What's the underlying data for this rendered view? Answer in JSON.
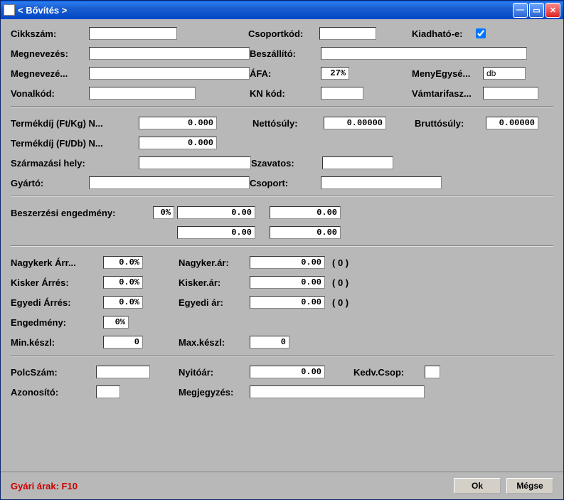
{
  "window": {
    "title": "<  Bővítés  >"
  },
  "labels": {
    "cikkszam": "Cikkszám:",
    "csoportkod": "Csoportkód:",
    "kiadhato": "Kiadható-e:",
    "megnevezes": "Megnevezés:",
    "beszallito": "Beszállító:",
    "megneveze": "Megnevezé...",
    "afa": "ÁFA:",
    "menyegyse": "MenyEgysé...",
    "vonalkod": "Vonalkód:",
    "knkod": "KN kód:",
    "vamtarifasz": "Vámtarifasz...",
    "termekdij_kg": "Termékdíj (Ft/Kg) N...",
    "nettosuly": "Nettósúly:",
    "bruttosuly": "Bruttósúly:",
    "termekdij_db": "Termékdíj (Ft/Db) N...",
    "szarmazasi": "Származási hely:",
    "szavatos": "Szavatos:",
    "gyarto": "Gyártó:",
    "csoport": "Csoport:",
    "beszerzesi_eng": "Beszerzési engedmény:",
    "nagykerk_arr": "Nagykerk Árr...",
    "nagyker_ar": "Nagyker.ár:",
    "kisker_arres": "Kisker Árrés:",
    "kisker_ar": "Kisker.ár:",
    "egyedi_arres": "Egyedi Árrés:",
    "egyedi_ar": "Egyedi ár:",
    "engedmeny": "Engedmény:",
    "minkeszl": "Min.készl:",
    "maxkeszl": "Max.készl:",
    "polcszam": "PolcSzám:",
    "nyitoar": "Nyitóár:",
    "kedv_csop": "Kedv.Csop:",
    "azonosito": "Azonosító:",
    "megjegyzes": "Megjegyzés:"
  },
  "values": {
    "afa": "27%",
    "menyegyse": "db",
    "termekdij_kg": "0.000",
    "termekdij_db": "0.000",
    "nettosuly": "0.00000",
    "bruttosuly": "0.00000",
    "besz_eng_pct": "0%",
    "besz_eng_1": "0.00",
    "besz_eng_2": "0.00",
    "besz_eng_3": "0.00",
    "besz_eng_4": "0.00",
    "nagykerk_arres": "0.0%",
    "nagyker_ar": "0.00",
    "kisker_arres": "0.0%",
    "kisker_ar": "0.00",
    "egyedi_arres": "0.0%",
    "egyedi_ar": "0.00",
    "engedmeny": "0%",
    "minkeszl": "0",
    "maxkeszl": "0",
    "nyitoar": "0.00"
  },
  "paren": {
    "nagyker": "(  0  )",
    "kisker": "(  0  )",
    "egyedi": "(  0  )"
  },
  "footer": {
    "text": "Gyári árak: F10",
    "ok": "Ok",
    "cancel": "Mégse"
  }
}
